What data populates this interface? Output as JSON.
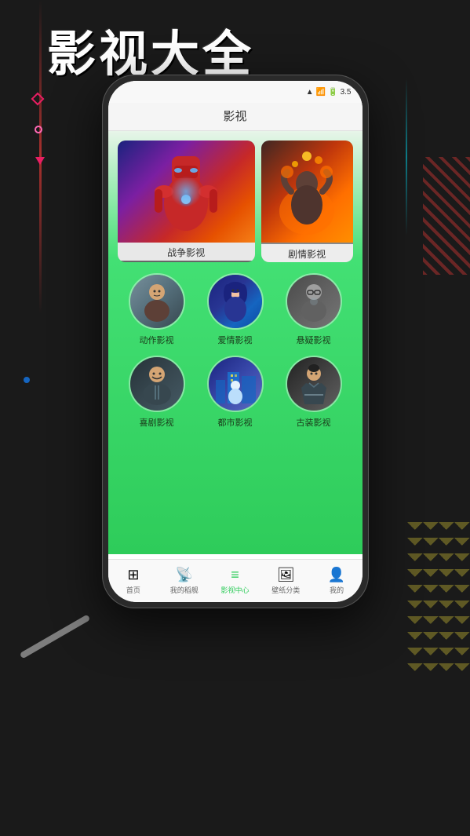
{
  "page": {
    "title": "影视大全",
    "background_color": "#1a1a1a"
  },
  "phone": {
    "status_bar": {
      "signal": "▲▼",
      "wifi": "WiFi",
      "battery": "3.5"
    },
    "header": {
      "title": "影视"
    },
    "featured": [
      {
        "id": "war",
        "label": "战争影视",
        "style": "iron-man"
      },
      {
        "id": "drama",
        "label": "剧情影视",
        "style": "aladdin"
      }
    ],
    "categories_row1": [
      {
        "id": "action",
        "label": "动作影视",
        "style": "action"
      },
      {
        "id": "romance",
        "label": "爱情影视",
        "style": "romance"
      },
      {
        "id": "mystery",
        "label": "悬疑影视",
        "style": "mystery"
      }
    ],
    "categories_row2": [
      {
        "id": "comedy",
        "label": "喜剧影视",
        "style": "comedy"
      },
      {
        "id": "city",
        "label": "都市影视",
        "style": "city"
      },
      {
        "id": "ancient",
        "label": "古装影视",
        "style": "ancient"
      }
    ],
    "nav": [
      {
        "id": "home",
        "label": "首页",
        "icon": "⊞",
        "active": false
      },
      {
        "id": "ship",
        "label": "我的稻舰",
        "icon": "📡",
        "active": false
      },
      {
        "id": "movie-center",
        "label": "影视中心",
        "icon": "≡",
        "active": true
      },
      {
        "id": "wallpaper",
        "label": "壁纸分类",
        "icon": "🖼",
        "active": false
      },
      {
        "id": "mine",
        "label": "我的",
        "icon": "👤",
        "active": false
      }
    ]
  }
}
